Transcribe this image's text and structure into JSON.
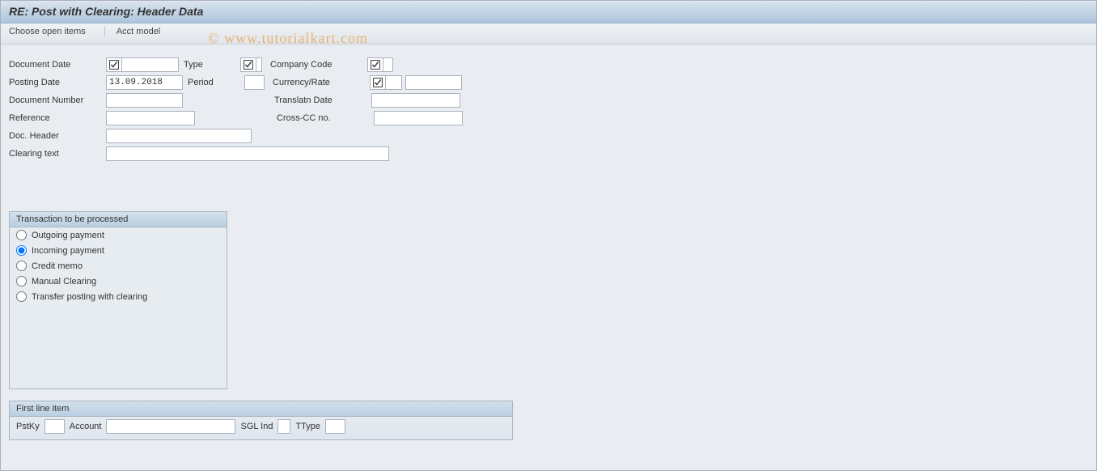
{
  "title": "RE: Post with Clearing: Header Data",
  "toolbar": {
    "choose": "Choose open items",
    "acct": "Acct model"
  },
  "watermark": "© www.tutorialkart.com",
  "form": {
    "doc_date_label": "Document Date",
    "doc_date_value": "",
    "type_label": "Type",
    "type_value": "",
    "company_label": "Company Code",
    "company_value": "",
    "posting_date_label": "Posting Date",
    "posting_date_value": "13.09.2018",
    "period_label": "Period",
    "period_value": "",
    "currency_label": "Currency/Rate",
    "currency_value": "",
    "currency_rate_value": "",
    "doc_number_label": "Document Number",
    "doc_number_value": "",
    "transl_date_label": "Translatn Date",
    "transl_date_value": "",
    "reference_label": "Reference",
    "reference_value": "",
    "crosscc_label": "Cross-CC no.",
    "crosscc_value": "",
    "doc_header_label": "Doc. Header",
    "doc_header_value": "",
    "clearing_text_label": "Clearing text",
    "clearing_text_value": ""
  },
  "trans": {
    "legend": "Transaction to be processed",
    "options": {
      "outgoing": "Outgoing payment",
      "incoming": "Incoming payment",
      "credit": "Credit memo",
      "manual": "Manual Clearing",
      "transfer": "Transfer posting with clearing"
    },
    "selected": "incoming"
  },
  "firstline": {
    "legend": "First line item",
    "pstky_label": "PstKy",
    "pstky_value": "",
    "account_label": "Account",
    "account_value": "",
    "sgl_label": "SGL Ind",
    "sgl_value": "",
    "ttype_label": "TType",
    "ttype_value": ""
  }
}
